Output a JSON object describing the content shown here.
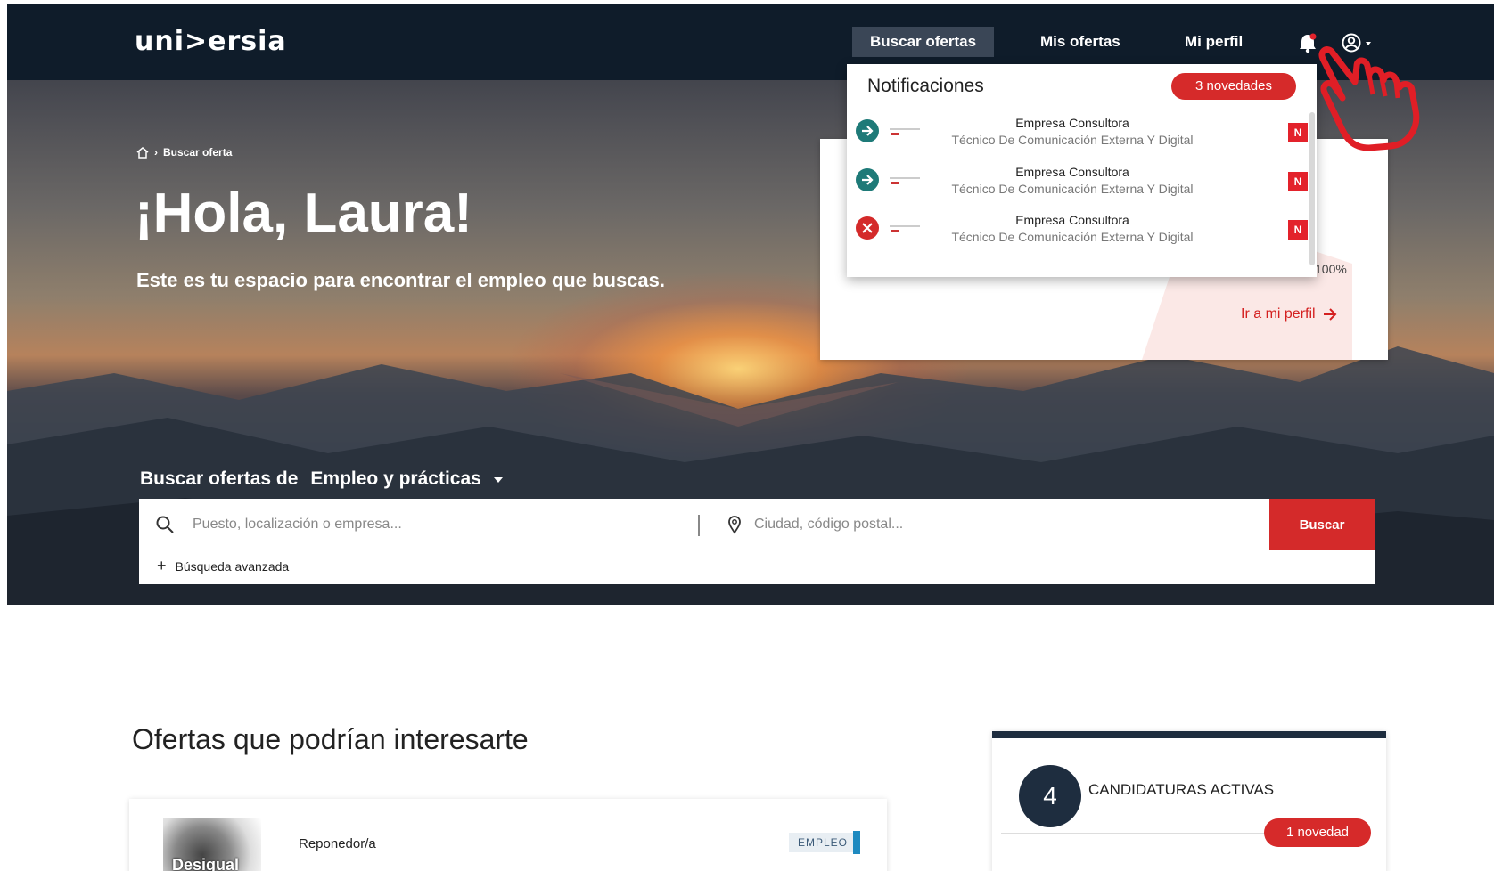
{
  "nav": {
    "logo": "uni>ersia",
    "items": [
      "Buscar ofertas",
      "Mis ofertas",
      "Mi perfil"
    ]
  },
  "breadcrumb": {
    "current": "Buscar oferta"
  },
  "hero": {
    "greeting": "¡Hola, Laura!",
    "subtitle": "Este es tu espacio para encontrar el empleo que buscas."
  },
  "profile_card": {
    "percent": "100%",
    "link_label": "Ir a mi perfil"
  },
  "notifications": {
    "title": "Notificaciones",
    "badge": "3 novedades",
    "items": [
      {
        "status": "arrow-right-icon",
        "company": "Empresa Consultora",
        "role": "Técnico De Comunicación Externa Y Digital",
        "flag": "N"
      },
      {
        "status": "arrow-right-icon",
        "company": "Empresa Consultora",
        "role": "Técnico De Comunicación Externa Y Digital",
        "flag": "N"
      },
      {
        "status": "close-icon",
        "company": "Empresa Consultora",
        "role": "Técnico De Comunicación Externa Y Digital",
        "flag": "N"
      }
    ]
  },
  "search": {
    "label_prefix": "Buscar ofertas de",
    "category": "Empleo y prácticas",
    "query_placeholder": "Puesto, localización o empresa...",
    "location_placeholder": "Ciudad, código postal...",
    "button": "Buscar",
    "advanced": "Búsqueda avanzada"
  },
  "offers": {
    "title": "Ofertas que podrían interesarte",
    "items": [
      {
        "logo_text": "Desigual",
        "title": "Reponedor/a",
        "tag": "EMPLEO"
      }
    ]
  },
  "candidaturas": {
    "count": "4",
    "label": "CANDIDATURAS ACTIVAS",
    "badge": "1 novedad"
  },
  "colors": {
    "nav_bg": "#0f1c2a",
    "accent_red": "#d42a2a",
    "teal": "#1e7a78",
    "dark_navy": "#1e2d3f"
  }
}
